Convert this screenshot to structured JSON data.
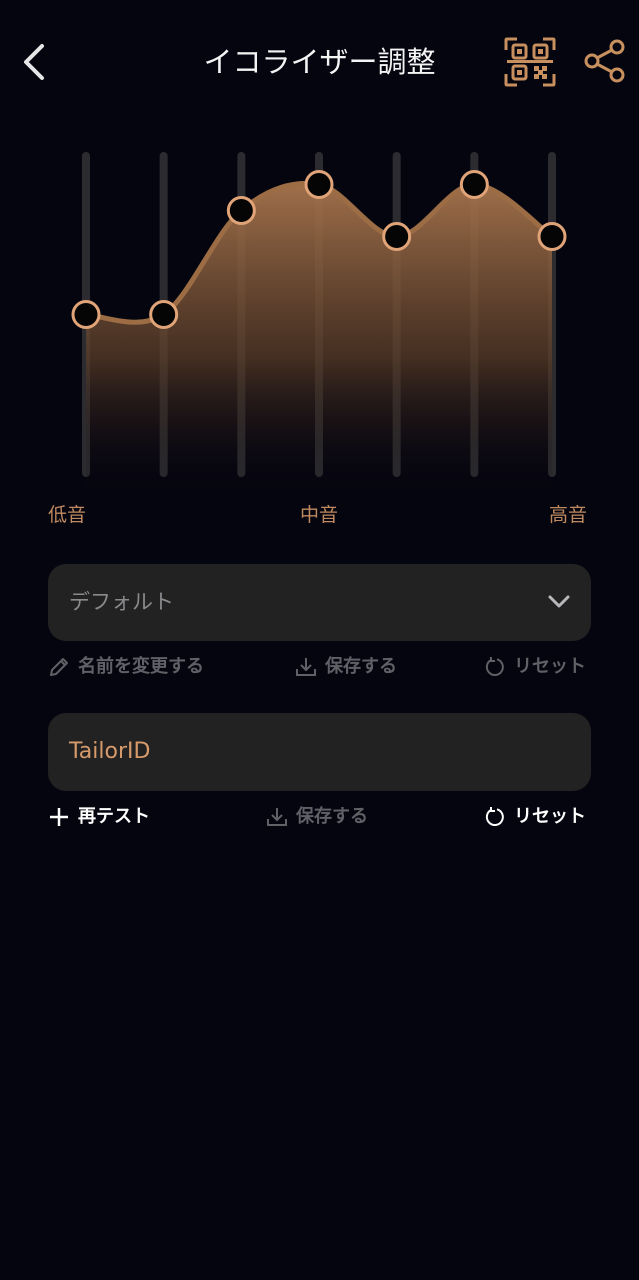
{
  "header": {
    "title": "イコライザー調整",
    "back_icon": "chevron-left-icon",
    "qr_icon": "qr-code-icon",
    "share_icon": "share-icon"
  },
  "equalizer": {
    "band_levels": [
      0.5,
      0.5,
      0.82,
      0.9,
      0.74,
      0.9,
      0.74
    ],
    "labels": {
      "low": "低音",
      "mid": "中音",
      "high": "高音"
    },
    "accent_color": "#c8905f",
    "track_color": "#2c2c30"
  },
  "preset": {
    "selected": "デフォルト",
    "actions": {
      "rename": "名前を変更する",
      "save": "保存する",
      "reset": "リセット"
    }
  },
  "tailor": {
    "label": "TailorID",
    "actions": {
      "retest": "再テスト",
      "save": "保存する",
      "reset": "リセット"
    }
  },
  "colors": {
    "background": "#05050f",
    "card": "#222223",
    "accent": "#d79a6a",
    "muted": "#606066"
  }
}
